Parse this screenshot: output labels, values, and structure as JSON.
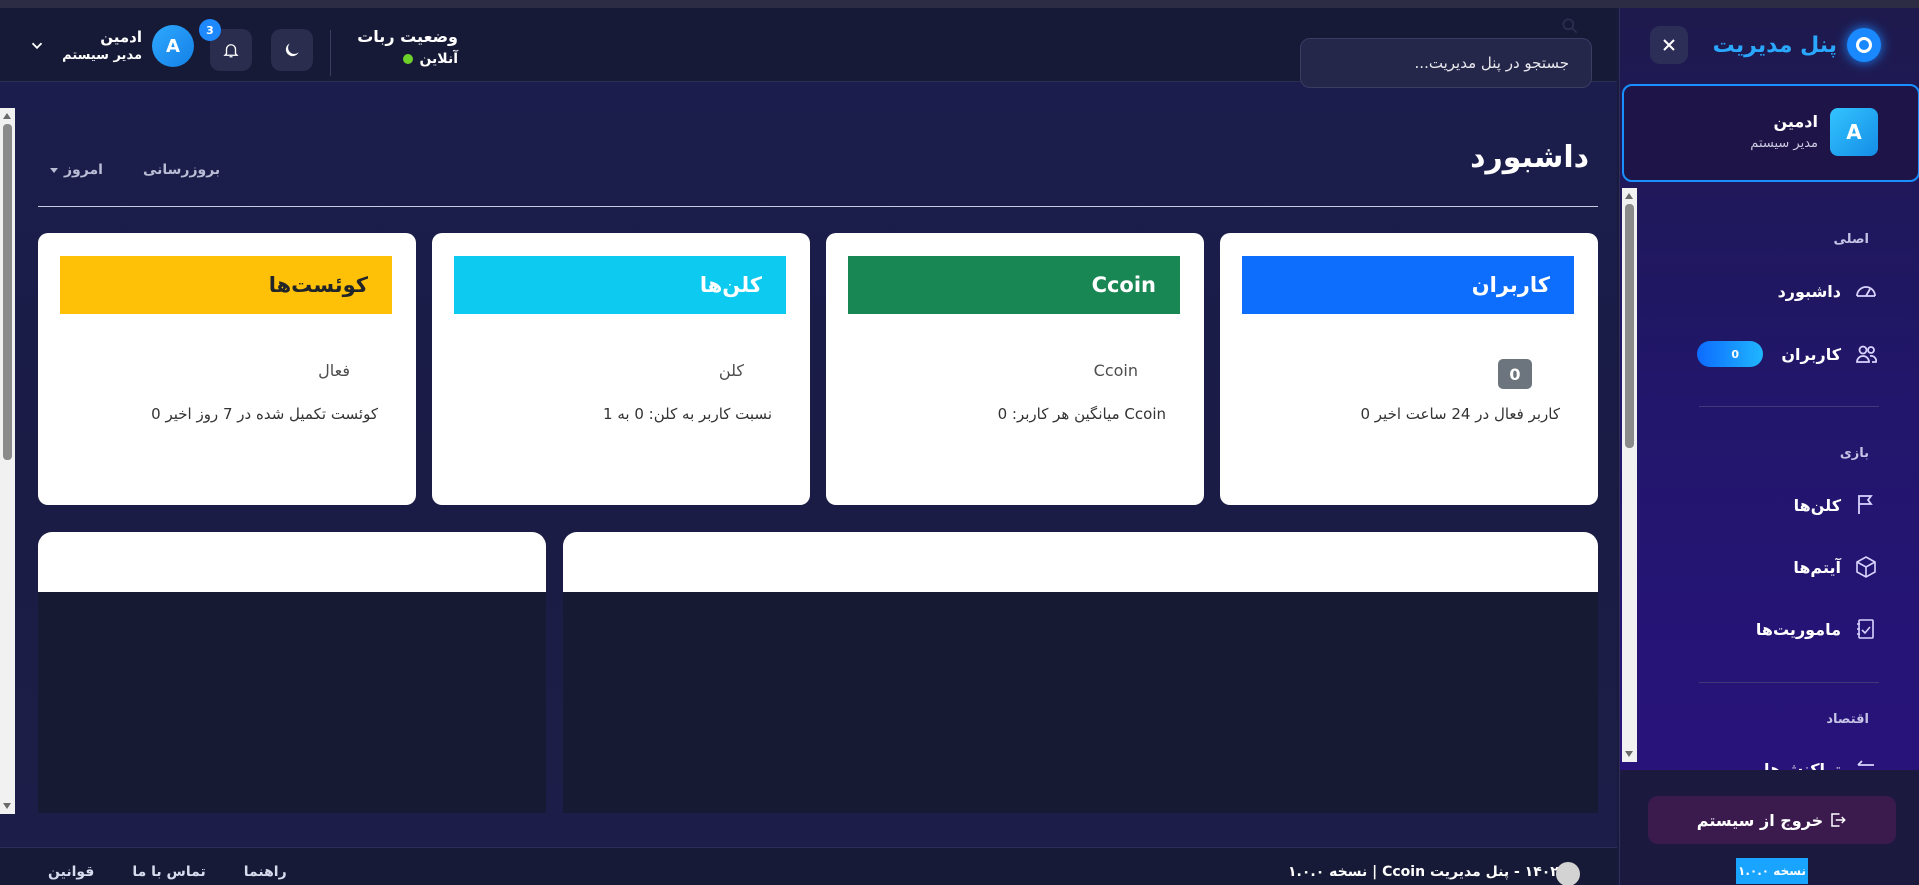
{
  "header": {
    "user_name": "ادمین",
    "user_role": "مدیر سیستم",
    "avatar_letter": "A",
    "notification_count": "3",
    "bot_status_title": "وضعیت ربات",
    "bot_status_value": "آنلاین",
    "search_placeholder": "جستجو در پنل مدیریت..."
  },
  "page": {
    "title": "داشبورد",
    "today_label": "امروز",
    "refresh_label": "بروزرسانی"
  },
  "cards": [
    {
      "title": "کاربران",
      "color": "#0d6efd",
      "count": "0",
      "subtitle": "0 کاربر فعال در 24 ساعت اخیر"
    },
    {
      "title": "Ccoin",
      "color": "#198754",
      "label": "Ccoin",
      "subtitle": "میانگین هر کاربر: 0 Ccoin"
    },
    {
      "title": "کلن‌ها",
      "color": "#0dcaf0",
      "label": "کلن",
      "subtitle": "نسبت کاربر به کلن: 0 به 1"
    },
    {
      "title": "کوئست‌ها",
      "color": "#ffc107",
      "label": "فعال",
      "subtitle": "0 کوئست تکمیل شده در 7 روز اخیر"
    }
  ],
  "footer": {
    "copyright": "© ۱۴۰۲ - پنل مدیریت Ccoin | نسخه ۱.۰.۰",
    "links": [
      "راهنما",
      "تماس با ما",
      "قوانین"
    ]
  },
  "sidebar": {
    "brand": "پنل مدیریت",
    "profile_name": "ادمین",
    "profile_role": "مدیر سیستم",
    "profile_letter": "A",
    "sections": {
      "main": "اصلی",
      "game": "بازی",
      "economy": "اقتصاد"
    },
    "items": {
      "dashboard": "داشبورد",
      "users": "کاربران",
      "users_count": "0",
      "clans": "کلن‌ها",
      "items": "آیتم‌ها",
      "missions": "ماموریت‌ها",
      "transactions": "تراکنش‌ها"
    },
    "logout": "خروج از سیستم",
    "version": "نسخه ۱.۰.۰"
  }
}
